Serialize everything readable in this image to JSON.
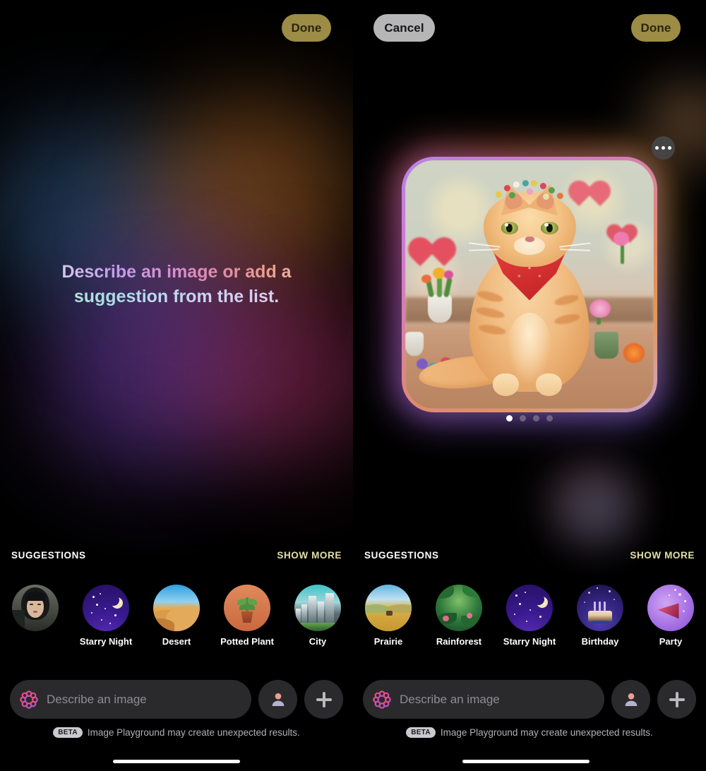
{
  "header": {
    "done_left_label": "Done",
    "cancel_label": "Cancel",
    "done_right_label": "Done",
    "done_color": "#9c8c45",
    "cancel_color": "#b6b6b6"
  },
  "left_pane": {
    "hero_line1": "Describe an image or add a",
    "hero_line2": "suggestion from the list.",
    "suggestions": {
      "section_title": "SUGGESTIONS",
      "show_more_label": "SHOW MORE",
      "items": [
        {
          "label": "",
          "icon": "person-photo-avatar",
          "theme": "t-person"
        },
        {
          "label": "Starry Night",
          "icon": "starry-night-icon",
          "theme": "t-starry"
        },
        {
          "label": "Desert",
          "icon": "desert-dune-icon",
          "theme": "t-desert"
        },
        {
          "label": "Potted Plant",
          "icon": "potted-plant-icon",
          "theme": "t-plant"
        },
        {
          "label": "City",
          "icon": "city-skyline-icon",
          "theme": "t-city"
        }
      ]
    },
    "composer": {
      "placeholder": "Describe an image",
      "value": "",
      "app_icon": "image-playground-flower-icon",
      "person_button_icon": "person-icon",
      "add_button_icon": "plus-icon"
    },
    "disclaimer": {
      "badge": "BETA",
      "text": "Image Playground may create unexpected results."
    }
  },
  "right_pane": {
    "image_card": {
      "alt": "Orange tabby cat wearing a red bandana and flower crown, surrounded by flowers and hearts",
      "more_button_icon": "ellipsis-icon",
      "page_dots_total": 4,
      "page_dots_active": 1
    },
    "suggestions": {
      "section_title": "SUGGESTIONS",
      "show_more_label": "SHOW MORE",
      "items": [
        {
          "label": "Prairie",
          "icon": "prairie-icon",
          "theme": "t-prairie"
        },
        {
          "label": "Rainforest",
          "icon": "rainforest-icon",
          "theme": "t-rain"
        },
        {
          "label": "Starry Night",
          "icon": "starry-night-icon",
          "theme": "t-starry"
        },
        {
          "label": "Birthday",
          "icon": "birthday-cake-icon",
          "theme": "t-bday"
        },
        {
          "label": "Party",
          "icon": "party-popper-icon",
          "theme": "t-party"
        }
      ]
    },
    "composer": {
      "placeholder": "Describe an image",
      "value": "",
      "app_icon": "image-playground-flower-icon",
      "person_button_icon": "person-icon",
      "add_button_icon": "plus-icon"
    },
    "disclaimer": {
      "badge": "BETA",
      "text": "Image Playground may create unexpected results."
    }
  }
}
